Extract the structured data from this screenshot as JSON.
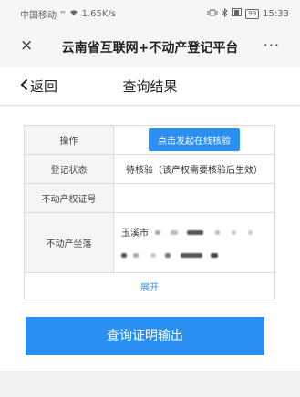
{
  "status_bar": {
    "carrier": "中国移动",
    "signal_glyph": "⁴⁶",
    "speed": "1.65K/s",
    "right_icons": "ᐧ ✱ ⌧",
    "battery": "99",
    "time": "15:33"
  },
  "nav": {
    "close": "×",
    "title": "云南省互联网+不动产登记平台",
    "more": "···"
  },
  "header": {
    "back_label": "返回",
    "title": "查询结果"
  },
  "table": {
    "rows": [
      {
        "label": "操作",
        "button": "点击发起在线核验"
      },
      {
        "label": "登记状态",
        "value": "待核验（该产权需要核验后生效）"
      },
      {
        "label": "不动产权证号",
        "value": ""
      },
      {
        "label": "不动产坐落",
        "value_prefix": "玉溪市"
      }
    ],
    "expand": "展开"
  },
  "submit": {
    "label": "查询证明输出"
  },
  "colors": {
    "accent": "#2a8ff2",
    "label_bg": "#f5f5f5",
    "page_bg": "#f2f2f2"
  }
}
